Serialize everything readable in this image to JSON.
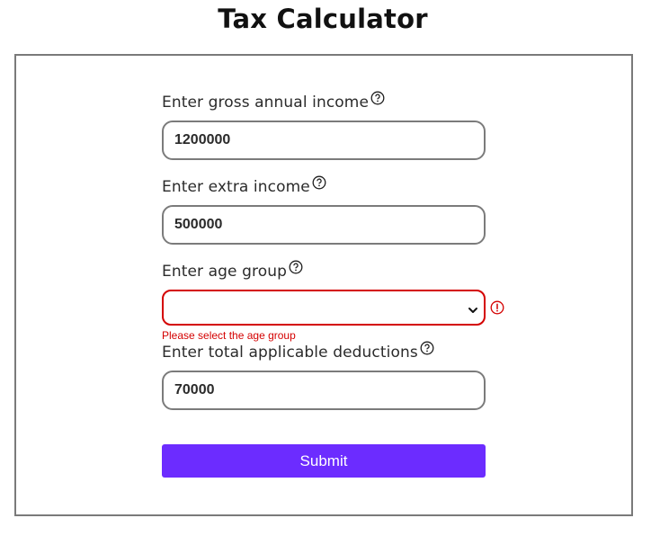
{
  "page": {
    "title": "Tax Calculator"
  },
  "form": {
    "gross_income": {
      "label": "Enter gross annual income",
      "value": "1200000"
    },
    "extra_income": {
      "label": "Enter extra income",
      "value": "500000"
    },
    "age_group": {
      "label": "Enter age group",
      "selected": "",
      "error": "Please select the age group"
    },
    "deductions": {
      "label": "Enter total applicable deductions",
      "value": "70000"
    },
    "submit_label": "Submit"
  },
  "colors": {
    "accent": "#6c2cff",
    "error": "#d40000",
    "border": "#7b7b7b"
  },
  "icons": {
    "help": "question-circle-icon",
    "error": "exclamation-circle-icon",
    "dropdown": "chevron-down-icon"
  }
}
